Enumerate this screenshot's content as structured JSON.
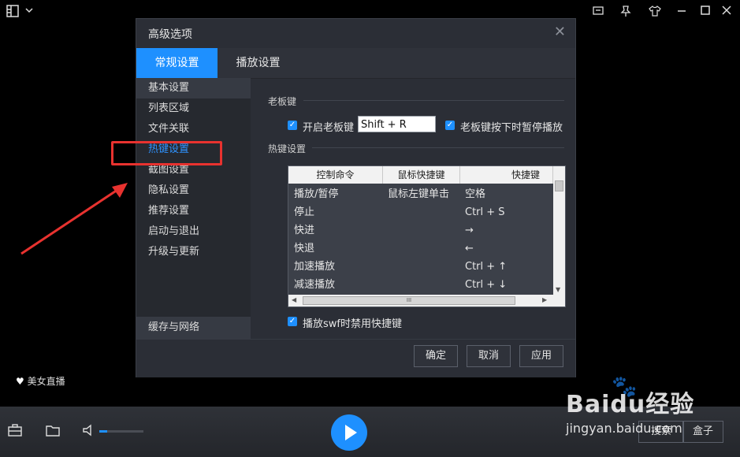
{
  "topbar": {
    "icons": [
      "menu-grid-icon",
      "chevron-down-icon",
      "chat-icon",
      "pin-icon",
      "skin-icon",
      "minimize-icon",
      "maximize-icon",
      "close-icon"
    ]
  },
  "dialog": {
    "title": "高级选项",
    "tabs": [
      {
        "label": "常规设置",
        "active": true
      },
      {
        "label": "播放设置",
        "active": false
      }
    ],
    "sidebar": {
      "items": [
        "基本设置",
        "列表区域",
        "文件关联",
        "热键设置",
        "截图设置",
        "隐私设置",
        "推荐设置",
        "启动与退出",
        "升级与更新"
      ],
      "selected_index": 0,
      "highlighted_index": 3,
      "bottom_item": "缓存与网络"
    },
    "boss_key": {
      "section_title": "老板键",
      "enable_label": "开启老板键",
      "enable_checked": true,
      "key_value": "Shift + R",
      "pause_label": "老板键按下时暂停播放",
      "pause_checked": true
    },
    "hotkeys": {
      "section_title": "热键设置",
      "columns": [
        "控制命令",
        "鼠标快捷键",
        "快捷键"
      ],
      "rows": [
        [
          "播放/暂停",
          "鼠标左键单击",
          "空格"
        ],
        [
          "停止",
          "",
          "Ctrl + S"
        ],
        [
          "快进",
          "",
          "→"
        ],
        [
          "快退",
          "",
          "←"
        ],
        [
          "加速播放",
          "",
          "Ctrl + ↑"
        ],
        [
          "减速播放",
          "",
          "Ctrl + ↓"
        ]
      ],
      "hscroll_grip": "III",
      "swf_label": "播放swf时禁用快捷键",
      "swf_checked": true
    },
    "buttons": {
      "ok": "确定",
      "cancel": "取消",
      "apply": "应用"
    },
    "close_glyph": "✕"
  },
  "left_badge": "美女直播",
  "bottom": {
    "right_left_label": "搜索",
    "right_right_label": "盒子"
  },
  "watermark": {
    "brand": "Baidu经验",
    "url": "jingyan.baidu.com"
  },
  "annotation": {
    "highlight_color": "#e8322f"
  }
}
